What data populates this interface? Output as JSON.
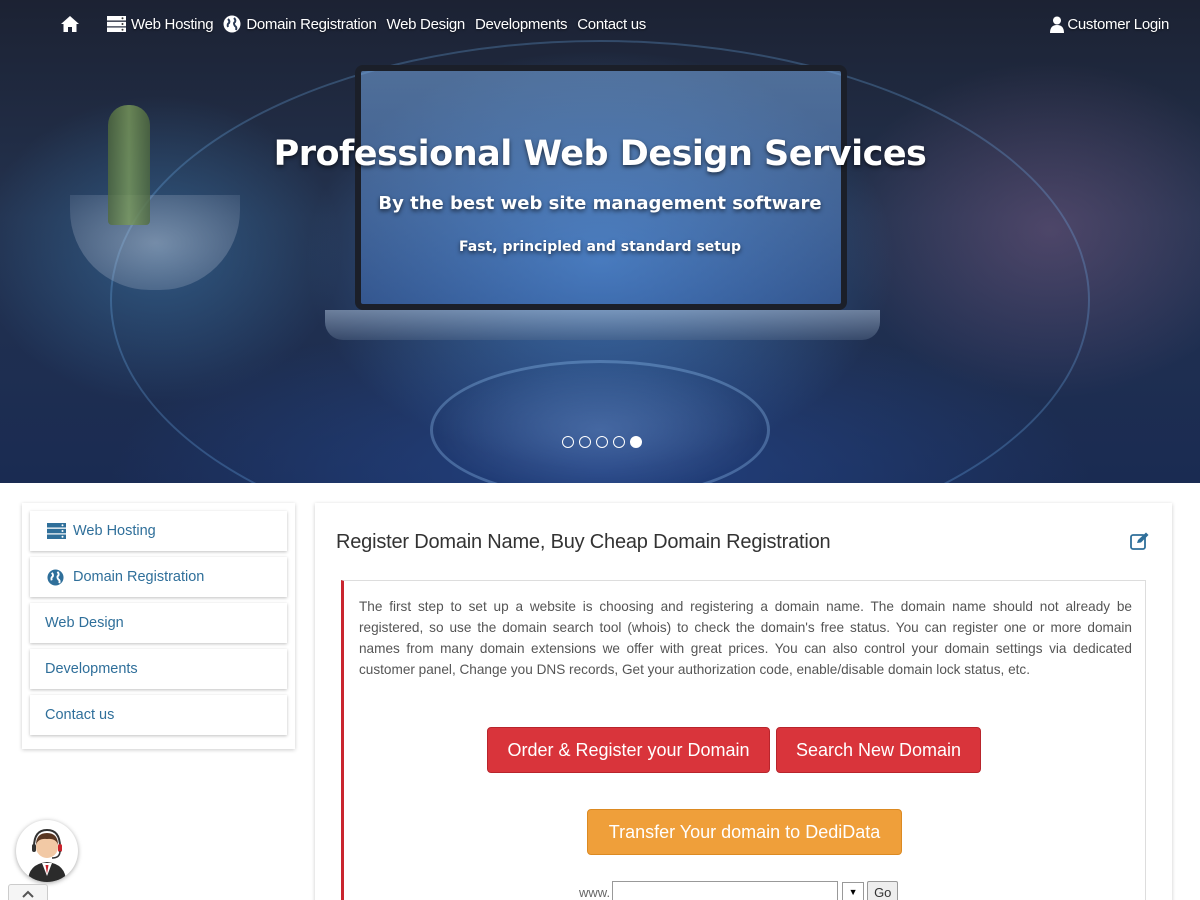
{
  "nav": {
    "items": [
      {
        "label": "Web Hosting",
        "icon": "server-icon"
      },
      {
        "label": "Domain Registration",
        "icon": "globe-icon"
      },
      {
        "label": "Web Design"
      },
      {
        "label": "Developments"
      },
      {
        "label": "Contact us"
      }
    ],
    "login_label": "Customer Login"
  },
  "hero": {
    "title": "Professional Web Design Services",
    "subtitle": "By the best web site management software",
    "tagline": "Fast, principled and standard setup",
    "slides_total": 5,
    "active_slide": 5
  },
  "sidebar": {
    "items": [
      {
        "label": "Web Hosting",
        "icon": "server-icon"
      },
      {
        "label": "Domain Registration",
        "icon": "globe-icon"
      },
      {
        "label": "Web Design"
      },
      {
        "label": "Developments"
      },
      {
        "label": "Contact us"
      }
    ]
  },
  "main": {
    "title": "Register Domain Name, Buy Cheap Domain Registration",
    "description": "The first step to set up a website is choosing and registering a domain name. The domain name should not already be registered, so use the domain search tool (whois) to check the domain's free status. You can register one or more domain names from many domain extensions we offer with great prices. You can also control your domain settings via dedicated customer panel, Change you DNS records, Get your authorization code, enable/disable domain lock status, etc.",
    "buttons": {
      "order": "Order & Register your Domain",
      "search": "Search New Domain",
      "transfer": "Transfer Your domain to DediData"
    },
    "whois": {
      "prefix": "www.",
      "input_value": "",
      "go_label": "Go"
    }
  },
  "colors": {
    "accent_red": "#d9343b",
    "accent_orange": "#ef9f3a",
    "link_blue": "#2f6f9a"
  }
}
